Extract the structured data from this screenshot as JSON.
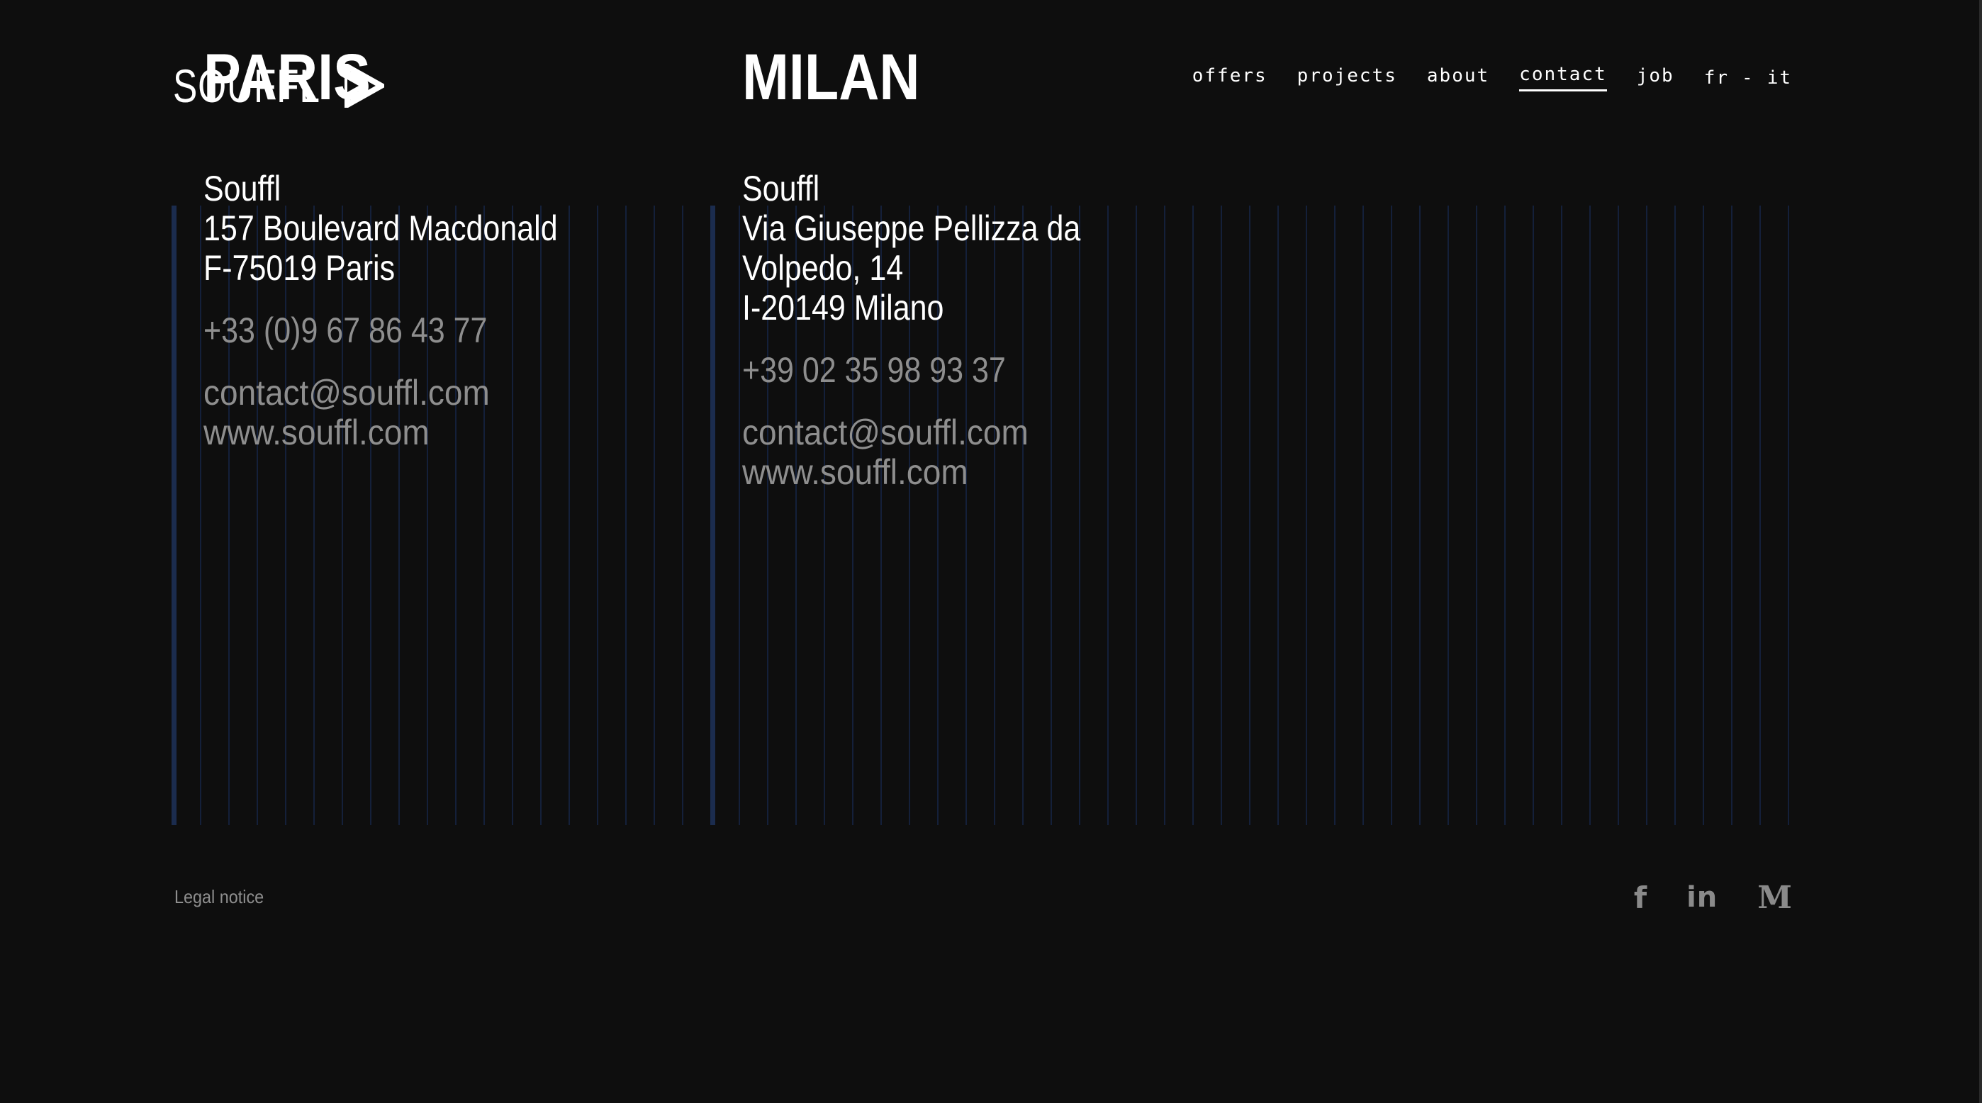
{
  "header": {
    "logo_text": "SOUFFL",
    "nav": {
      "offers": "offers",
      "projects": "projects",
      "about": "about",
      "contact": "contact",
      "job": "job"
    },
    "lang": {
      "fr": "fr",
      "sep": "-",
      "it": "it"
    }
  },
  "offices": {
    "paris": {
      "city": "PARIS",
      "name": "Souffl",
      "address_line1": "157 Boulevard Macdonald",
      "address_line2": "F-75019 Paris",
      "phone": "+33 (0)9 67 86 43 77",
      "email": "contact@souffl.com",
      "website": "www.souffl.com"
    },
    "milan": {
      "city": "MILAN",
      "name": "Souffl",
      "address_line1": "Via Giuseppe Pellizza da",
      "address_line2": "Volpedo, 14",
      "address_line3": "I-20149 Milano",
      "phone": "+39 02 35 98 93 37",
      "email": "contact@souffl.com",
      "website": "www.souffl.com"
    }
  },
  "footer": {
    "legal": "Legal notice",
    "social": {
      "facebook": "f",
      "linkedin": "in",
      "medium": "M"
    }
  },
  "colors": {
    "background": "#0e0e0e",
    "text": "#ffffff",
    "muted": "#8e8e8e",
    "grid_line": "#14203a",
    "accent_rule": "#1b2c4e"
  }
}
